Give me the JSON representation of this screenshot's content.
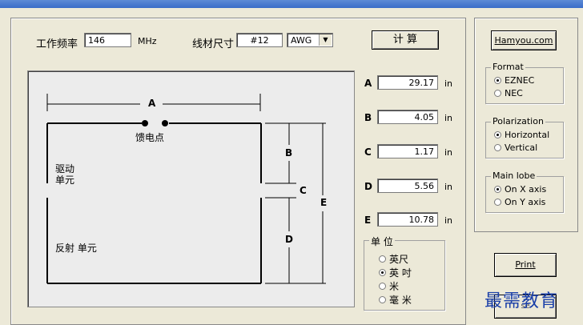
{
  "toolbar": {
    "freq_label": "工作频率",
    "freq_value": "146",
    "freq_unit": "MHz",
    "wire_label": "线材尺寸",
    "wire_value": "#12",
    "wire_unit_select": "AWG",
    "calc_button": "计  算"
  },
  "dimensions": [
    {
      "letter": "A",
      "value": "29.17",
      "unit": "in"
    },
    {
      "letter": "B",
      "value": "4.05",
      "unit": "in"
    },
    {
      "letter": "C",
      "value": "1.17",
      "unit": "in"
    },
    {
      "letter": "D",
      "value": "5.56",
      "in_unit": "in",
      "unit": "in"
    },
    {
      "letter": "E",
      "value": "10.78",
      "unit": "in"
    }
  ],
  "units_group": {
    "title": "单  位",
    "options": [
      {
        "label": "英尺",
        "selected": false
      },
      {
        "label": "英 吋",
        "selected": true
      },
      {
        "label": "米",
        "selected": false
      },
      {
        "label": "毫 米",
        "selected": false
      }
    ]
  },
  "diagram": {
    "label_A": "A",
    "label_B": "B",
    "label_C": "C",
    "label_D": "D",
    "label_E": "E",
    "feedpoint": "馈电点",
    "driven_line1": "驱动",
    "driven_line2": "单元",
    "reflector": "反射 单元"
  },
  "side": {
    "hamyou_button": "Hamyou.com",
    "format": {
      "title": "Format",
      "options": [
        {
          "label": "EZNEC",
          "selected": true
        },
        {
          "label": "NEC",
          "selected": false
        }
      ]
    },
    "polarization": {
      "title": "Polarization",
      "options": [
        {
          "label": "Horizontal",
          "selected": true
        },
        {
          "label": "Vertical",
          "selected": false
        }
      ]
    },
    "mainlobe": {
      "title": "Main lobe",
      "options": [
        {
          "label": "On X axis",
          "selected": true
        },
        {
          "label": "On Y axis",
          "selected": false
        }
      ]
    },
    "print_button": "Print",
    "close_button_partial": "se"
  },
  "watermark": "最需教育"
}
